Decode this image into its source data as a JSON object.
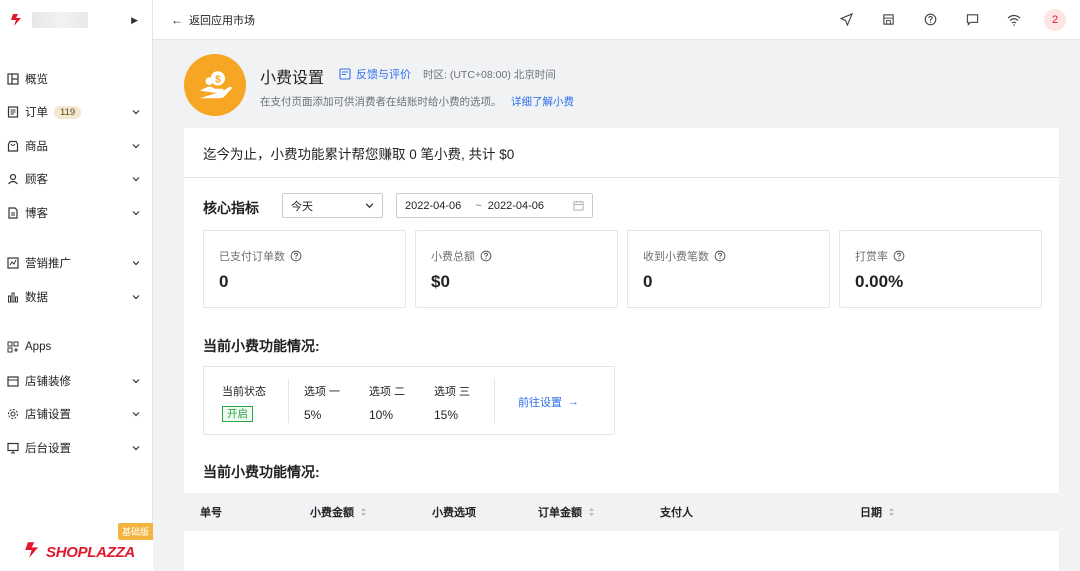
{
  "sidebar": {
    "items": [
      {
        "label": "概览",
        "icon": "overview-icon",
        "chevron": false
      },
      {
        "label": "订单",
        "icon": "orders-icon",
        "badge": "119",
        "chevron": true
      },
      {
        "label": "商品",
        "icon": "products-icon",
        "chevron": true
      },
      {
        "label": "顾客",
        "icon": "customers-icon",
        "chevron": true
      },
      {
        "label": "博客",
        "icon": "blog-icon",
        "chevron": true
      },
      {
        "label": "营销推广",
        "icon": "marketing-icon",
        "chevron": true
      },
      {
        "label": "数据",
        "icon": "analytics-icon",
        "chevron": true
      },
      {
        "label": "Apps",
        "icon": "apps-icon",
        "chevron": false
      },
      {
        "label": "店铺装修",
        "icon": "store-design-icon",
        "chevron": true
      },
      {
        "label": "店铺设置",
        "icon": "store-settings-icon",
        "chevron": true
      },
      {
        "label": "后台设置",
        "icon": "admin-settings-icon",
        "chevron": true
      }
    ],
    "brand_tag": "基础版",
    "brand_name": "SHOPLAZZA"
  },
  "topbar": {
    "back_label": "返回应用市场",
    "icons": [
      "send-icon",
      "store-icon",
      "help-icon",
      "chat-icon",
      "wifi-icon"
    ],
    "avatar": "2"
  },
  "header": {
    "title": "小费设置",
    "feedback": "反馈与评价",
    "timezone": "时区: (UTC+08:00) 北京时间",
    "description": "在支付页面添加可供消费者在结账时给小费的选项。",
    "learn_more": "详细了解小费"
  },
  "summary": "迄今为止，小费功能累计帮您赚取 0 笔小费, 共计 $0",
  "core": {
    "title": "核心指标",
    "period": "今天",
    "date_start": "2022-04-06",
    "date_sep": "~",
    "date_end": "2022-04-06",
    "metrics": [
      {
        "label": "已支付订单数",
        "value": "0"
      },
      {
        "label": "小费总额",
        "value": "$0"
      },
      {
        "label": "收到小费笔数",
        "value": "0"
      },
      {
        "label": "打赏率",
        "value": "0.00%"
      }
    ]
  },
  "status_section": {
    "title": "当前小费功能情况:",
    "status_label": "当前状态",
    "status_value": "开启",
    "options": [
      {
        "label": "选项 一",
        "value": "5%"
      },
      {
        "label": "选项 二",
        "value": "10%"
      },
      {
        "label": "选项 三",
        "value": "15%"
      }
    ],
    "goto": "前往设置"
  },
  "table_section": {
    "title": "当前小费功能情况:",
    "columns": [
      {
        "label": "单号",
        "sortable": false
      },
      {
        "label": "小费金额",
        "sortable": true
      },
      {
        "label": "小费选项",
        "sortable": false
      },
      {
        "label": "订单金额",
        "sortable": true
      },
      {
        "label": "支付人",
        "sortable": false
      },
      {
        "label": "日期",
        "sortable": true
      }
    ]
  },
  "colors": {
    "brand": "#e0182d",
    "accent": "#2f6fed",
    "header_icon": "#f6a623",
    "status_on": "#2aa54a"
  }
}
